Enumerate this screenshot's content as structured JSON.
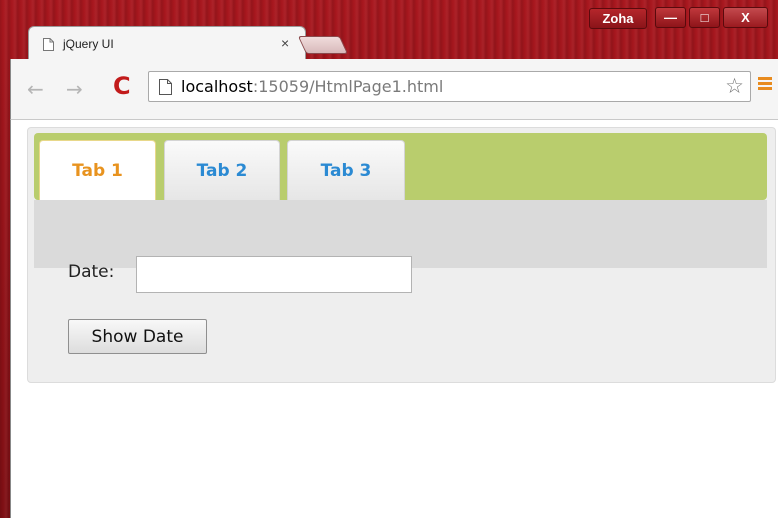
{
  "window": {
    "profile_name": "Zoha",
    "minimize_label": "—",
    "maximize_label": "□",
    "close_label": "X"
  },
  "browser": {
    "tab_title": "jQuery UI",
    "tab_close": "×",
    "url_host": "localhost",
    "url_path": ":15059/HtmlPage1.html",
    "back_glyph": "←",
    "forward_glyph": "→",
    "reload_glyph": "C",
    "star_glyph": "☆"
  },
  "page": {
    "tabs": [
      {
        "label": "Tab 1",
        "active": true
      },
      {
        "label": "Tab 2",
        "active": false
      },
      {
        "label": "Tab 3",
        "active": false
      }
    ],
    "form": {
      "date_label": "Date:",
      "date_value": "",
      "button_label": "Show Date"
    }
  },
  "colors": {
    "tabs_header_bg": "#b9cd6d",
    "active_tab_text": "#e8931f",
    "inactive_tab_text": "#2b8ad3",
    "frame_red": "#8e1117"
  }
}
